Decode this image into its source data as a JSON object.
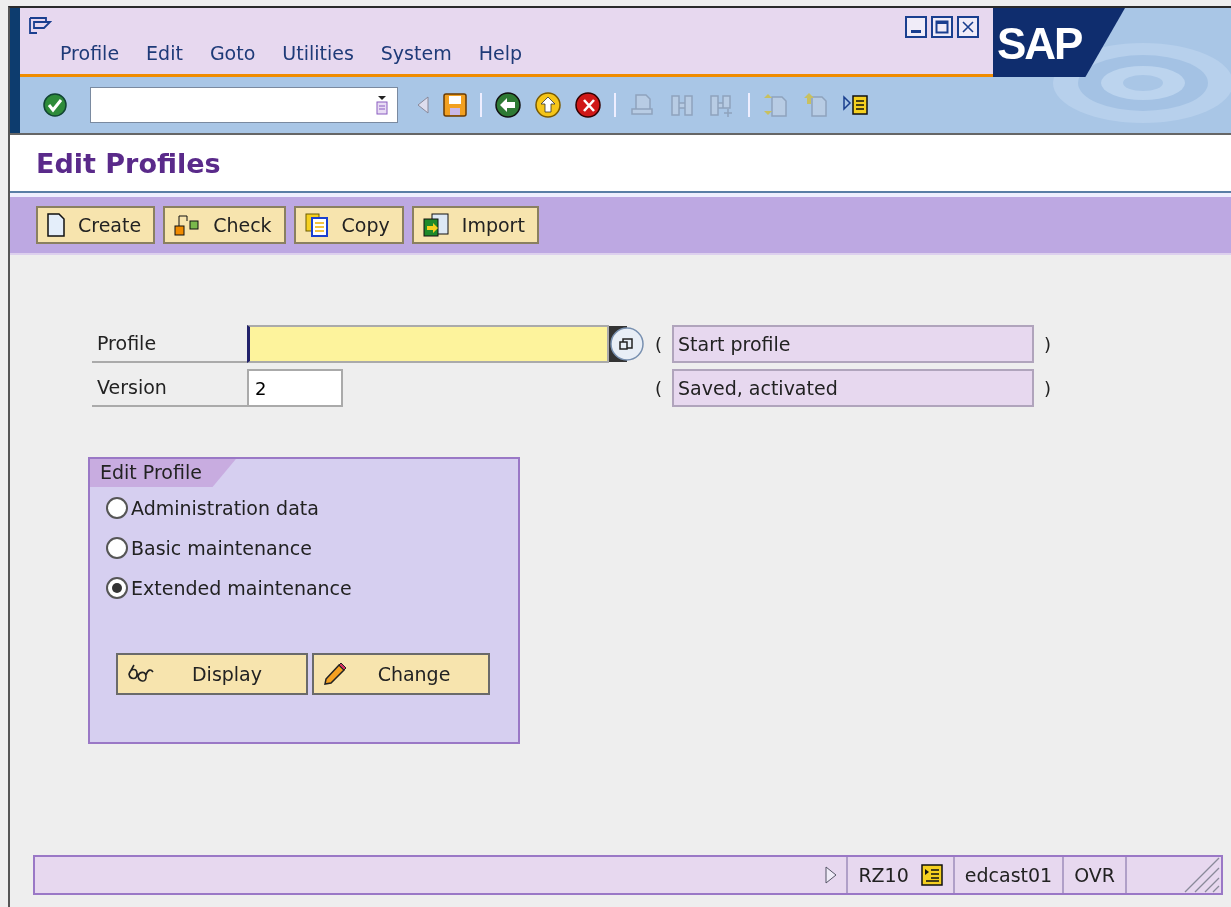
{
  "menu": [
    "Profile",
    "Edit",
    "Goto",
    "Utilities",
    "System",
    "Help"
  ],
  "logo": "SAP",
  "title": "Edit Profiles",
  "app_toolbar": [
    {
      "label": "Create"
    },
    {
      "label": "Check"
    },
    {
      "label": "Copy"
    },
    {
      "label": "Import"
    }
  ],
  "fields": [
    {
      "label": "Profile",
      "focused": true,
      "open": "(",
      "description": "Start profile",
      "close": ")"
    },
    {
      "label": "Version",
      "value": "2",
      "focused": false,
      "open": "(",
      "description": "Saved, activated",
      "close": ")"
    }
  ],
  "group": {
    "title": "Edit Profile",
    "options": [
      {
        "label": "Administration data",
        "selected": false
      },
      {
        "label": "Basic maintenance",
        "selected": false
      },
      {
        "label": "Extended maintenance",
        "selected": true
      }
    ],
    "buttons": [
      {
        "label": "Display"
      },
      {
        "label": "Change"
      }
    ]
  },
  "status_bar": {
    "transaction": "RZ10",
    "user": "edcast01",
    "mode": "OVR"
  }
}
